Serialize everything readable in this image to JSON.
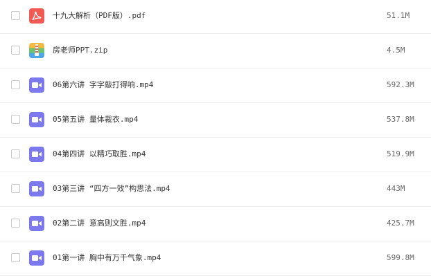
{
  "files": [
    {
      "name": "十九大解析（PDF版）.pdf",
      "size": "51.1M",
      "type": "pdf",
      "icon": "pdf-icon"
    },
    {
      "name": "房老师PPT.zip",
      "size": "4.5M",
      "type": "zip",
      "icon": "zip-icon"
    },
    {
      "name": "06第六讲 字字敲打得响.mp4",
      "size": "592.3M",
      "type": "video",
      "icon": "video-icon"
    },
    {
      "name": "05第五讲 量体裁衣.mp4",
      "size": "537.8M",
      "type": "video",
      "icon": "video-icon"
    },
    {
      "name": "04第四讲 以精巧取胜.mp4",
      "size": "519.9M",
      "type": "video",
      "icon": "video-icon"
    },
    {
      "name": "03第三讲 “四方一效”构思法.mp4",
      "size": "443M",
      "type": "video",
      "icon": "video-icon"
    },
    {
      "name": "02第二讲 意高则文胜.mp4",
      "size": "425.7M",
      "type": "video",
      "icon": "video-icon"
    },
    {
      "name": "01第一讲 胸中有万千气象.mp4",
      "size": "599.8M",
      "type": "video",
      "icon": "video-icon"
    }
  ],
  "colors": {
    "pdf": "#f25a54",
    "video": "#7c79ee"
  }
}
